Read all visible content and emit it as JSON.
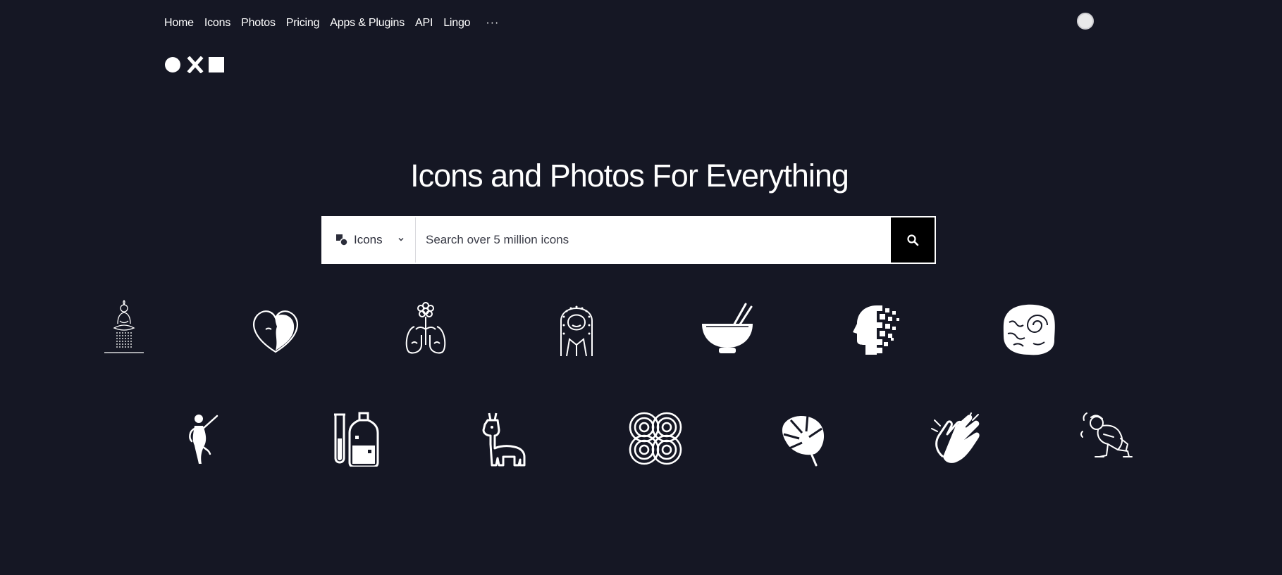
{
  "nav": {
    "items": [
      {
        "label": "Home"
      },
      {
        "label": "Icons"
      },
      {
        "label": "Photos"
      },
      {
        "label": "Pricing"
      },
      {
        "label": "Apps & Plugins"
      },
      {
        "label": "API"
      },
      {
        "label": "Lingo"
      }
    ],
    "more_label": "···"
  },
  "hero": {
    "title": "Icons and Photos For Everything"
  },
  "search": {
    "type_label": "Icons",
    "placeholder": "Search over 5 million icons"
  },
  "icons": {
    "row1": [
      "meditating-buddha-icon",
      "heart-face-icon",
      "flower-lungs-icon",
      "woman-portrait-icon",
      "bowl-chopsticks-icon",
      "pixelated-head-icon",
      "ammonite-fossil-icon"
    ],
    "row2": [
      "dancer-icon",
      "test-tube-bottle-icon",
      "llama-icon",
      "interlocking-circles-icon",
      "monstera-leaf-icon",
      "clapping-hands-icon",
      "crouching-person-icon"
    ]
  },
  "colors": {
    "background": "#151724",
    "foreground": "#ffffff",
    "search_button": "#000000"
  }
}
